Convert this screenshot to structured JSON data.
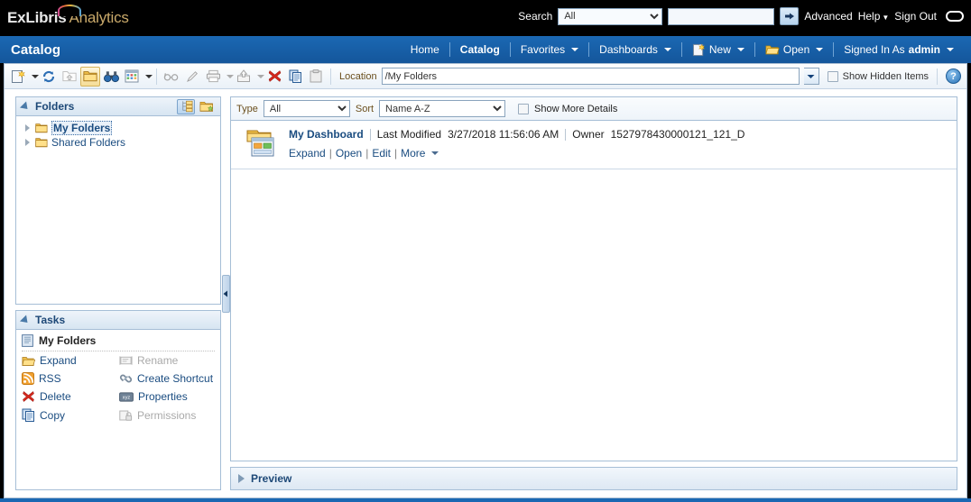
{
  "brand": {
    "primary": "ExLibris",
    "secondary": "Analytics"
  },
  "colors": {
    "nav_blue": "#1b68b3",
    "link_blue": "#1a4c80",
    "label_brown": "#6b4f1d",
    "panel_border": "#a6bed6"
  },
  "header": {
    "search_label": "Search",
    "search_scope": "All",
    "search_scope_options": [
      "All"
    ],
    "search_value": "",
    "go_icon": "arrow-right-icon",
    "advanced": "Advanced",
    "help": "Help",
    "sign_out": "Sign Out"
  },
  "nav": {
    "title": "Catalog",
    "items": [
      {
        "label": "Home",
        "icon": "",
        "caret": false,
        "active": false
      },
      {
        "label": "Catalog",
        "icon": "",
        "caret": false,
        "active": true
      },
      {
        "label": "Favorites",
        "icon": "",
        "caret": true,
        "active": false
      },
      {
        "label": "Dashboards",
        "icon": "",
        "caret": true,
        "active": false
      },
      {
        "label": "New",
        "icon": "new-page-icon",
        "caret": true,
        "active": false
      },
      {
        "label": "Open",
        "icon": "open-folder-icon",
        "caret": true,
        "active": false
      }
    ],
    "signed_in_as_label": "Signed In As",
    "user": "admin"
  },
  "toolbar": {
    "buttons": [
      {
        "name": "new-icon",
        "caret": true,
        "enabled": true,
        "pressed": false
      },
      {
        "name": "refresh-icon",
        "caret": false,
        "enabled": true,
        "pressed": false
      },
      {
        "name": "up-folder-icon",
        "caret": false,
        "enabled": false,
        "pressed": false
      },
      {
        "name": "show-folders-icon",
        "caret": false,
        "enabled": true,
        "pressed": true
      },
      {
        "name": "search-binoculars-icon",
        "caret": false,
        "enabled": true,
        "pressed": false
      },
      {
        "name": "view-grid-icon",
        "caret": true,
        "enabled": true,
        "pressed": false
      },
      {
        "name": "preview-glasses-icon",
        "caret": false,
        "enabled": false,
        "pressed": false
      },
      {
        "name": "edit-pencil-icon",
        "caret": false,
        "enabled": false,
        "pressed": false
      },
      {
        "name": "print-icon",
        "caret": true,
        "enabled": false,
        "pressed": false
      },
      {
        "name": "export-icon",
        "caret": true,
        "enabled": false,
        "pressed": false
      },
      {
        "name": "delete-icon",
        "caret": false,
        "enabled": true,
        "pressed": false
      },
      {
        "name": "copy-icon",
        "caret": false,
        "enabled": true,
        "pressed": false
      },
      {
        "name": "paste-icon",
        "caret": false,
        "enabled": false,
        "pressed": false
      }
    ],
    "location_label": "Location",
    "location_value": "/My Folders",
    "show_hidden_items": "Show Hidden Items",
    "show_hidden_checked": false,
    "help_glyph": "?"
  },
  "folders_panel": {
    "title": "Folders",
    "actions": [
      {
        "name": "tree-view-toggle",
        "pressed": true
      },
      {
        "name": "new-folder-icon",
        "pressed": false
      }
    ],
    "tree": [
      {
        "label": "My Folders",
        "selected": true
      },
      {
        "label": "Shared Folders",
        "selected": false
      }
    ]
  },
  "tasks_panel": {
    "title": "Tasks",
    "context_label": "My Folders",
    "items": [
      {
        "label": "Expand",
        "icon": "expand-folder-icon",
        "enabled": true
      },
      {
        "label": "Rename",
        "icon": "rename-icon",
        "enabled": false
      },
      {
        "label": "RSS",
        "icon": "rss-icon",
        "enabled": true
      },
      {
        "label": "Create Shortcut",
        "icon": "shortcut-link-icon",
        "enabled": true
      },
      {
        "label": "Delete",
        "icon": "delete-icon",
        "enabled": true
      },
      {
        "label": "Properties",
        "icon": "properties-icon",
        "enabled": true
      },
      {
        "label": "Copy",
        "icon": "copy-icon",
        "enabled": true
      },
      {
        "label": "Permissions",
        "icon": "permissions-lock-icon",
        "enabled": false
      }
    ]
  },
  "content": {
    "type_label": "Type",
    "type_value": "All",
    "type_options": [
      "All"
    ],
    "sort_label": "Sort",
    "sort_value": "Name A-Z",
    "sort_options": [
      "Name A-Z"
    ],
    "show_more_details": "Show More Details",
    "show_more_checked": false,
    "items": [
      {
        "icon": "dashboard-icon",
        "name": "My Dashboard",
        "modified_label": "Last Modified",
        "modified_value": "3/27/2018 11:56:06 AM",
        "owner_label": "Owner",
        "owner_value": "1527978430000121_121_D",
        "actions": [
          "Expand",
          "Open",
          "Edit",
          "More"
        ]
      }
    ]
  },
  "preview": {
    "title": "Preview",
    "expanded": false
  }
}
